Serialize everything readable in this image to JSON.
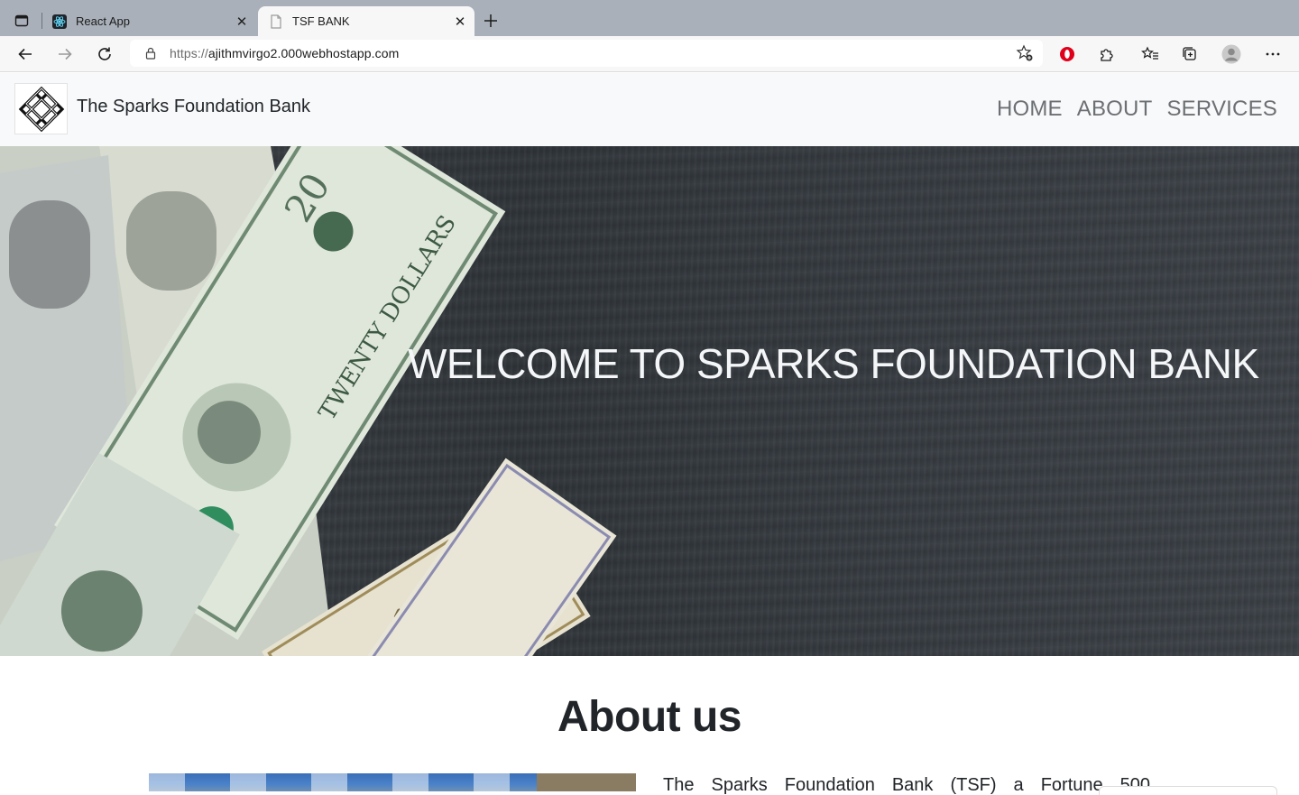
{
  "browser": {
    "tabs": [
      {
        "title": "React App",
        "favicon": "react-icon",
        "active": false
      },
      {
        "title": "TSF BANK",
        "favicon": "page-icon",
        "active": true
      }
    ],
    "address": {
      "scheme": "https://",
      "host": "ajithmvirgo2.000webhostapp.com"
    },
    "toolbar_icons": [
      "opera-icon",
      "extensions-icon",
      "favorites-icon",
      "collections-icon",
      "profile-icon",
      "more-icon"
    ]
  },
  "site": {
    "brand": "The Sparks Foundation Bank",
    "nav": [
      "HOME",
      "ABOUT",
      "SERVICES"
    ],
    "hero": {
      "heading": "WELCOME TO SPARKS FOUNDATION BANK"
    },
    "about": {
      "title": "About us",
      "text": "The Sparks Foundation Bank (TSF) a Fortune 500"
    }
  },
  "colors": {
    "tabbar": "#a9b0b9",
    "navbar": "#f8f9fa",
    "hero_bg": "#33383e",
    "heading": "#212529"
  }
}
